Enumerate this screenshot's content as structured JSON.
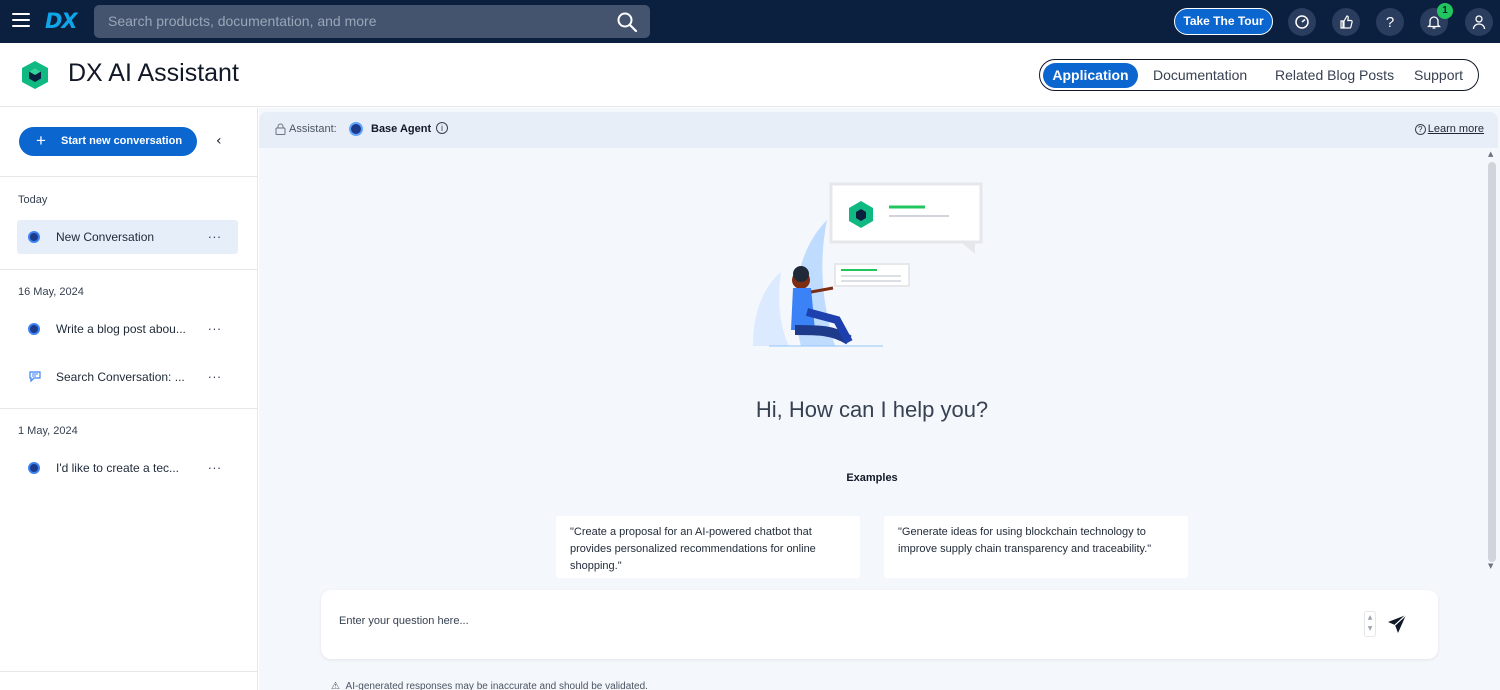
{
  "topbar": {
    "logo_text": "DX",
    "search_placeholder": "Search products, documentation, and more",
    "tour_button": "Take The Tour",
    "notification_count": "1"
  },
  "header": {
    "app_title": "DX AI Assistant",
    "tabs": [
      {
        "label": "Application",
        "active": true
      },
      {
        "label": "Documentation",
        "active": false
      },
      {
        "label": "Related Blog Posts",
        "active": false
      },
      {
        "label": "Support",
        "active": false
      }
    ]
  },
  "sidebar": {
    "new_conversation_label": "Start new conversation",
    "groups": [
      {
        "label": "Today",
        "items": [
          {
            "title": "New Conversation",
            "icon": "agent-icon"
          }
        ]
      },
      {
        "label": "16 May, 2024",
        "items": [
          {
            "title": "Write a blog post abou...",
            "icon": "agent-icon"
          },
          {
            "title": "Search Conversation: ...",
            "icon": "search-conversation-icon"
          }
        ]
      },
      {
        "label": "1 May, 2024",
        "items": [
          {
            "title": "I'd like to create a tec...",
            "icon": "agent-icon"
          }
        ]
      }
    ],
    "more_label": "..."
  },
  "assistant_bar": {
    "label": "Assistant:",
    "agent_name": "Base Agent",
    "learn_more": "Learn more"
  },
  "main": {
    "greeting": "Hi, How can I help you?",
    "examples_title": "Examples",
    "examples": [
      "\"Create a proposal for an AI-powered chatbot that provides personalized recommendations for online shopping.\"",
      "\"Generate ideas for using blockchain technology to improve supply chain transparency and traceability.\""
    ]
  },
  "input": {
    "placeholder": "Enter your question here...",
    "disclaimer": "AI-generated responses may be inaccurate and should be validated."
  },
  "colors": {
    "topbar_bg": "#0b1f3f",
    "accent": "#0b66d0",
    "brand_green": "#10b981",
    "badge": "#22c55e"
  }
}
